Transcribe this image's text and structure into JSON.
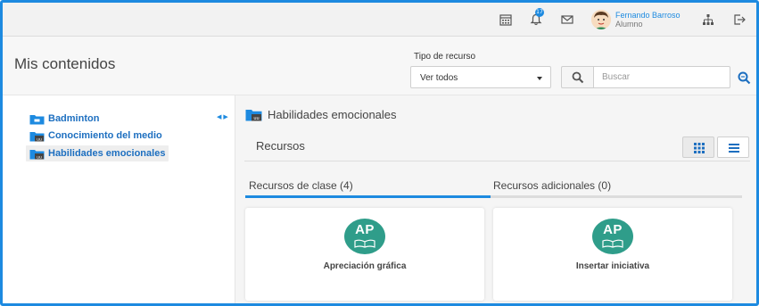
{
  "topbar": {
    "notifications_count": "17",
    "user_name": "Fernando Barroso",
    "user_role": "Alumno",
    "icons": [
      "calendar-icon",
      "bell-icon",
      "mail-icon",
      "sitemap-icon",
      "logout-icon"
    ]
  },
  "header": {
    "title": "Mis contenidos",
    "filter_label": "Tipo de recurso",
    "filter_value": "Ver todos",
    "search_placeholder": "Buscar"
  },
  "sidebar": {
    "items": [
      {
        "label": "Badminton",
        "selected": false
      },
      {
        "label": "Conocimiento del medio",
        "selected": false
      },
      {
        "label": "Habilidades emocionales",
        "selected": true
      }
    ]
  },
  "main": {
    "breadcrumb": "Habilidades emocionales",
    "section_title": "Recursos",
    "tabs": [
      {
        "label": "Recursos de clase (4)",
        "active": true
      },
      {
        "label": "Recursos adicionales (0)",
        "active": false
      }
    ],
    "cards": [
      {
        "badge": "AP",
        "title": "Apreciación gráfica"
      },
      {
        "badge": "AP",
        "title": "Insertar iniciativa"
      }
    ]
  },
  "colors": {
    "accent": "#1d8ae0",
    "badge": "#2f9d8a",
    "tab_inactive_line": "#dcdcdc"
  }
}
